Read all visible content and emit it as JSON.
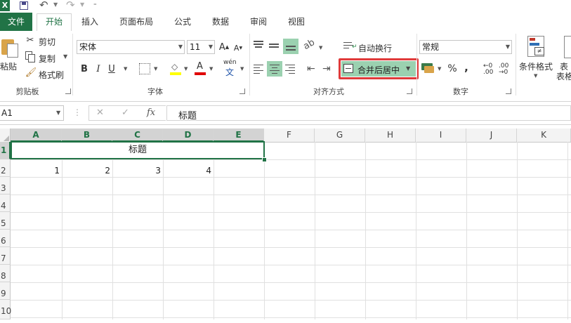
{
  "app": {
    "logo": "X"
  },
  "tabs": [
    "文件",
    "开始",
    "插入",
    "页面布局",
    "公式",
    "数据",
    "审阅",
    "视图"
  ],
  "clipboard": {
    "paste": "粘贴",
    "cut": "剪切",
    "copy": "复制",
    "format_painter": "格式刷",
    "group": "剪贴板"
  },
  "font": {
    "name": "宋体",
    "size": "11",
    "grow": "A",
    "shrink": "A",
    "bold": "B",
    "italic": "I",
    "underline": "U",
    "font_color_label": "A",
    "phonetic": "wén",
    "phonetic_char": "文",
    "group": "字体"
  },
  "alignment": {
    "wrap_text": "自动换行",
    "merge_center": "合并后居中",
    "group": "对齐方式"
  },
  "number": {
    "format": "常规",
    "percent": "%",
    "comma": ",",
    "group": "数字"
  },
  "styles": {
    "conditional": "条件格式",
    "table": "表格"
  },
  "formula_bar": {
    "name_box": "A1",
    "cancel": "✕",
    "enter": "✓",
    "fx": "fx",
    "content": "标题"
  },
  "columns": [
    "A",
    "B",
    "C",
    "D",
    "E",
    "F",
    "G",
    "H",
    "I",
    "J",
    "K"
  ],
  "rows": [
    "1",
    "2",
    "3",
    "4",
    "5",
    "6",
    "7",
    "8",
    "9",
    "10"
  ],
  "cells": {
    "merged_title": "标题",
    "row2": [
      "1",
      "2",
      "3",
      "4"
    ]
  },
  "colors": {
    "excel_green": "#217346",
    "highlight_red": "#e03a3a",
    "merge_fill": "#9bd1b0"
  }
}
